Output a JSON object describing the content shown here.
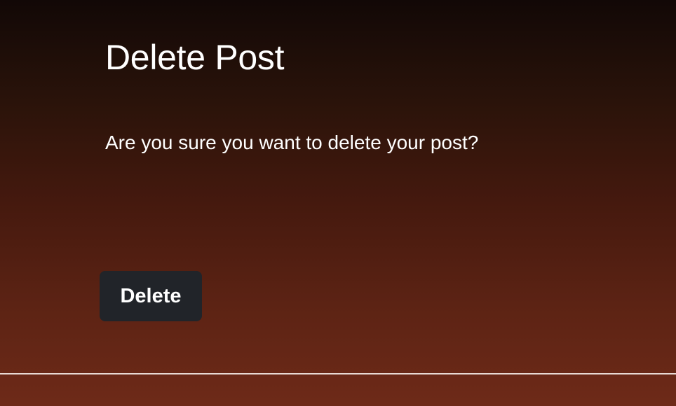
{
  "page": {
    "title": "Delete Post",
    "message": "Are you sure you want to delete your post?"
  },
  "actions": {
    "delete_label": "Delete"
  },
  "colors": {
    "background_top": "#120806",
    "background_bottom": "#6e2a18",
    "button_bg": "#212429",
    "text": "#ffffff"
  }
}
